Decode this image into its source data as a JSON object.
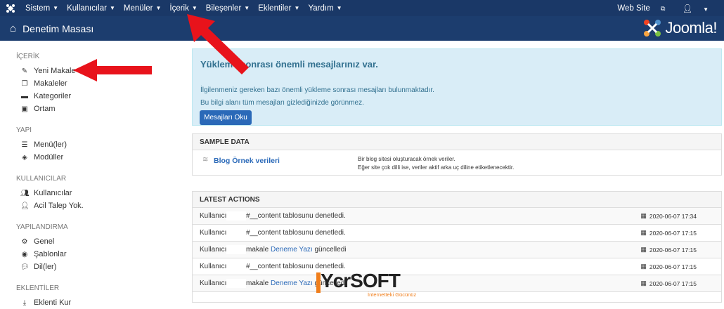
{
  "topbar": {
    "menu": [
      {
        "label": "Sistem"
      },
      {
        "label": "Kullanıcılar"
      },
      {
        "label": "Menüler"
      },
      {
        "label": "İçerik"
      },
      {
        "label": "Bileşenler"
      },
      {
        "label": "Eklentiler"
      },
      {
        "label": "Yardım"
      }
    ],
    "website_label": "Web Site"
  },
  "header": {
    "title": "Denetim Masası",
    "brand": "Joomla!"
  },
  "sidebar": {
    "sections": [
      {
        "title": "İÇERİK",
        "links": [
          {
            "label": "Yeni Makale",
            "icon": "pencil-icon"
          },
          {
            "label": "Makaleler",
            "icon": "copy-icon"
          },
          {
            "label": "Kategoriler",
            "icon": "folder-icon"
          },
          {
            "label": "Ortam",
            "icon": "image-icon"
          }
        ]
      },
      {
        "title": "YAPI",
        "links": [
          {
            "label": "Menü(ler)",
            "icon": "list-icon"
          },
          {
            "label": "Modüller",
            "icon": "cube-icon"
          }
        ]
      },
      {
        "title": "KULLANICILAR",
        "links": [
          {
            "label": "Kullanıcılar",
            "icon": "users-icon"
          },
          {
            "label": "Acil Talep Yok.",
            "icon": "user-icon"
          }
        ]
      },
      {
        "title": "YAPILANDIRMA",
        "links": [
          {
            "label": "Genel",
            "icon": "cog-icon"
          },
          {
            "label": "Şablonlar",
            "icon": "eye-icon"
          },
          {
            "label": "Dil(ler)",
            "icon": "comments-icon"
          }
        ]
      },
      {
        "title": "EKLENTİLER",
        "links": [
          {
            "label": "Eklenti Kur",
            "icon": "download-icon"
          }
        ]
      }
    ]
  },
  "alert": {
    "title": "Yükleme sonrası önemli mesajlarınız var.",
    "line1": "İlgilenmeniz gereken bazı önemli yükleme sonrası mesajları bulunmaktadır.",
    "line2": "Bu bilgi alanı tüm mesajları gizlediğinizde görünmez.",
    "button": "Mesajları Oku"
  },
  "sample_data": {
    "title": "SAMPLE DATA",
    "link": "Blog Örnek verileri",
    "desc1": "Bir blog sitesi oluşturacak örnek veriler.",
    "desc2": "Eğer site çok dilli ise, veriler aktif arka uç diline etiketlenecektir."
  },
  "latest_actions": {
    "title": "LATEST ACTIONS",
    "rows": [
      {
        "user": "Kullanıcı",
        "pre": "#__content tablosunu denetledi.",
        "link": "",
        "post": "",
        "date": "2020-06-07 17:34"
      },
      {
        "user": "Kullanıcı",
        "pre": "#__content tablosunu denetledi.",
        "link": "",
        "post": "",
        "date": "2020-06-07 17:15"
      },
      {
        "user": "Kullanıcı",
        "pre": "makale ",
        "link": "Deneme Yazı",
        "post": " güncelledi",
        "date": "2020-06-07 17:15"
      },
      {
        "user": "Kullanıcı",
        "pre": "#__content tablosunu denetledi.",
        "link": "",
        "post": "",
        "date": "2020-06-07 17:15"
      },
      {
        "user": "Kullanıcı",
        "pre": "makale ",
        "link": "Deneme Yazı",
        "post": " güncelledi",
        "date": "2020-06-07 17:15"
      }
    ]
  },
  "watermark": {
    "text": "YcrSOFT",
    "sub": "İnternetteki Gücünüz"
  },
  "colors": {
    "topbar": "#1a3867",
    "header": "#1c3d6e",
    "accent": "#2a69b8",
    "arrow": "#e8131b",
    "alert_bg": "#d9edf7"
  }
}
